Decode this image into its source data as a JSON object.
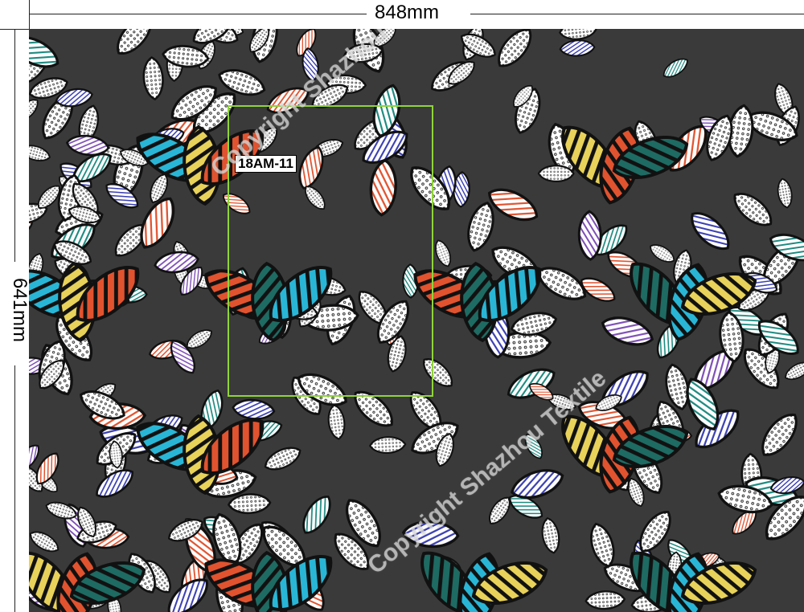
{
  "dimensions": {
    "width_label": "848mm",
    "height_label": "641mm"
  },
  "design": {
    "code": "18AM-11",
    "watermark": "Copyright Shazhou Textile",
    "background_color": "#3a3a3a",
    "repeat_box_color": "#8fd43a",
    "motif": "leaf-pattern",
    "leaf_colors": [
      "#ffffff",
      "#29b6d6",
      "#e8d25a",
      "#e1532f",
      "#1e6b63",
      "#3a3fb2",
      "#7e4fb5"
    ]
  }
}
